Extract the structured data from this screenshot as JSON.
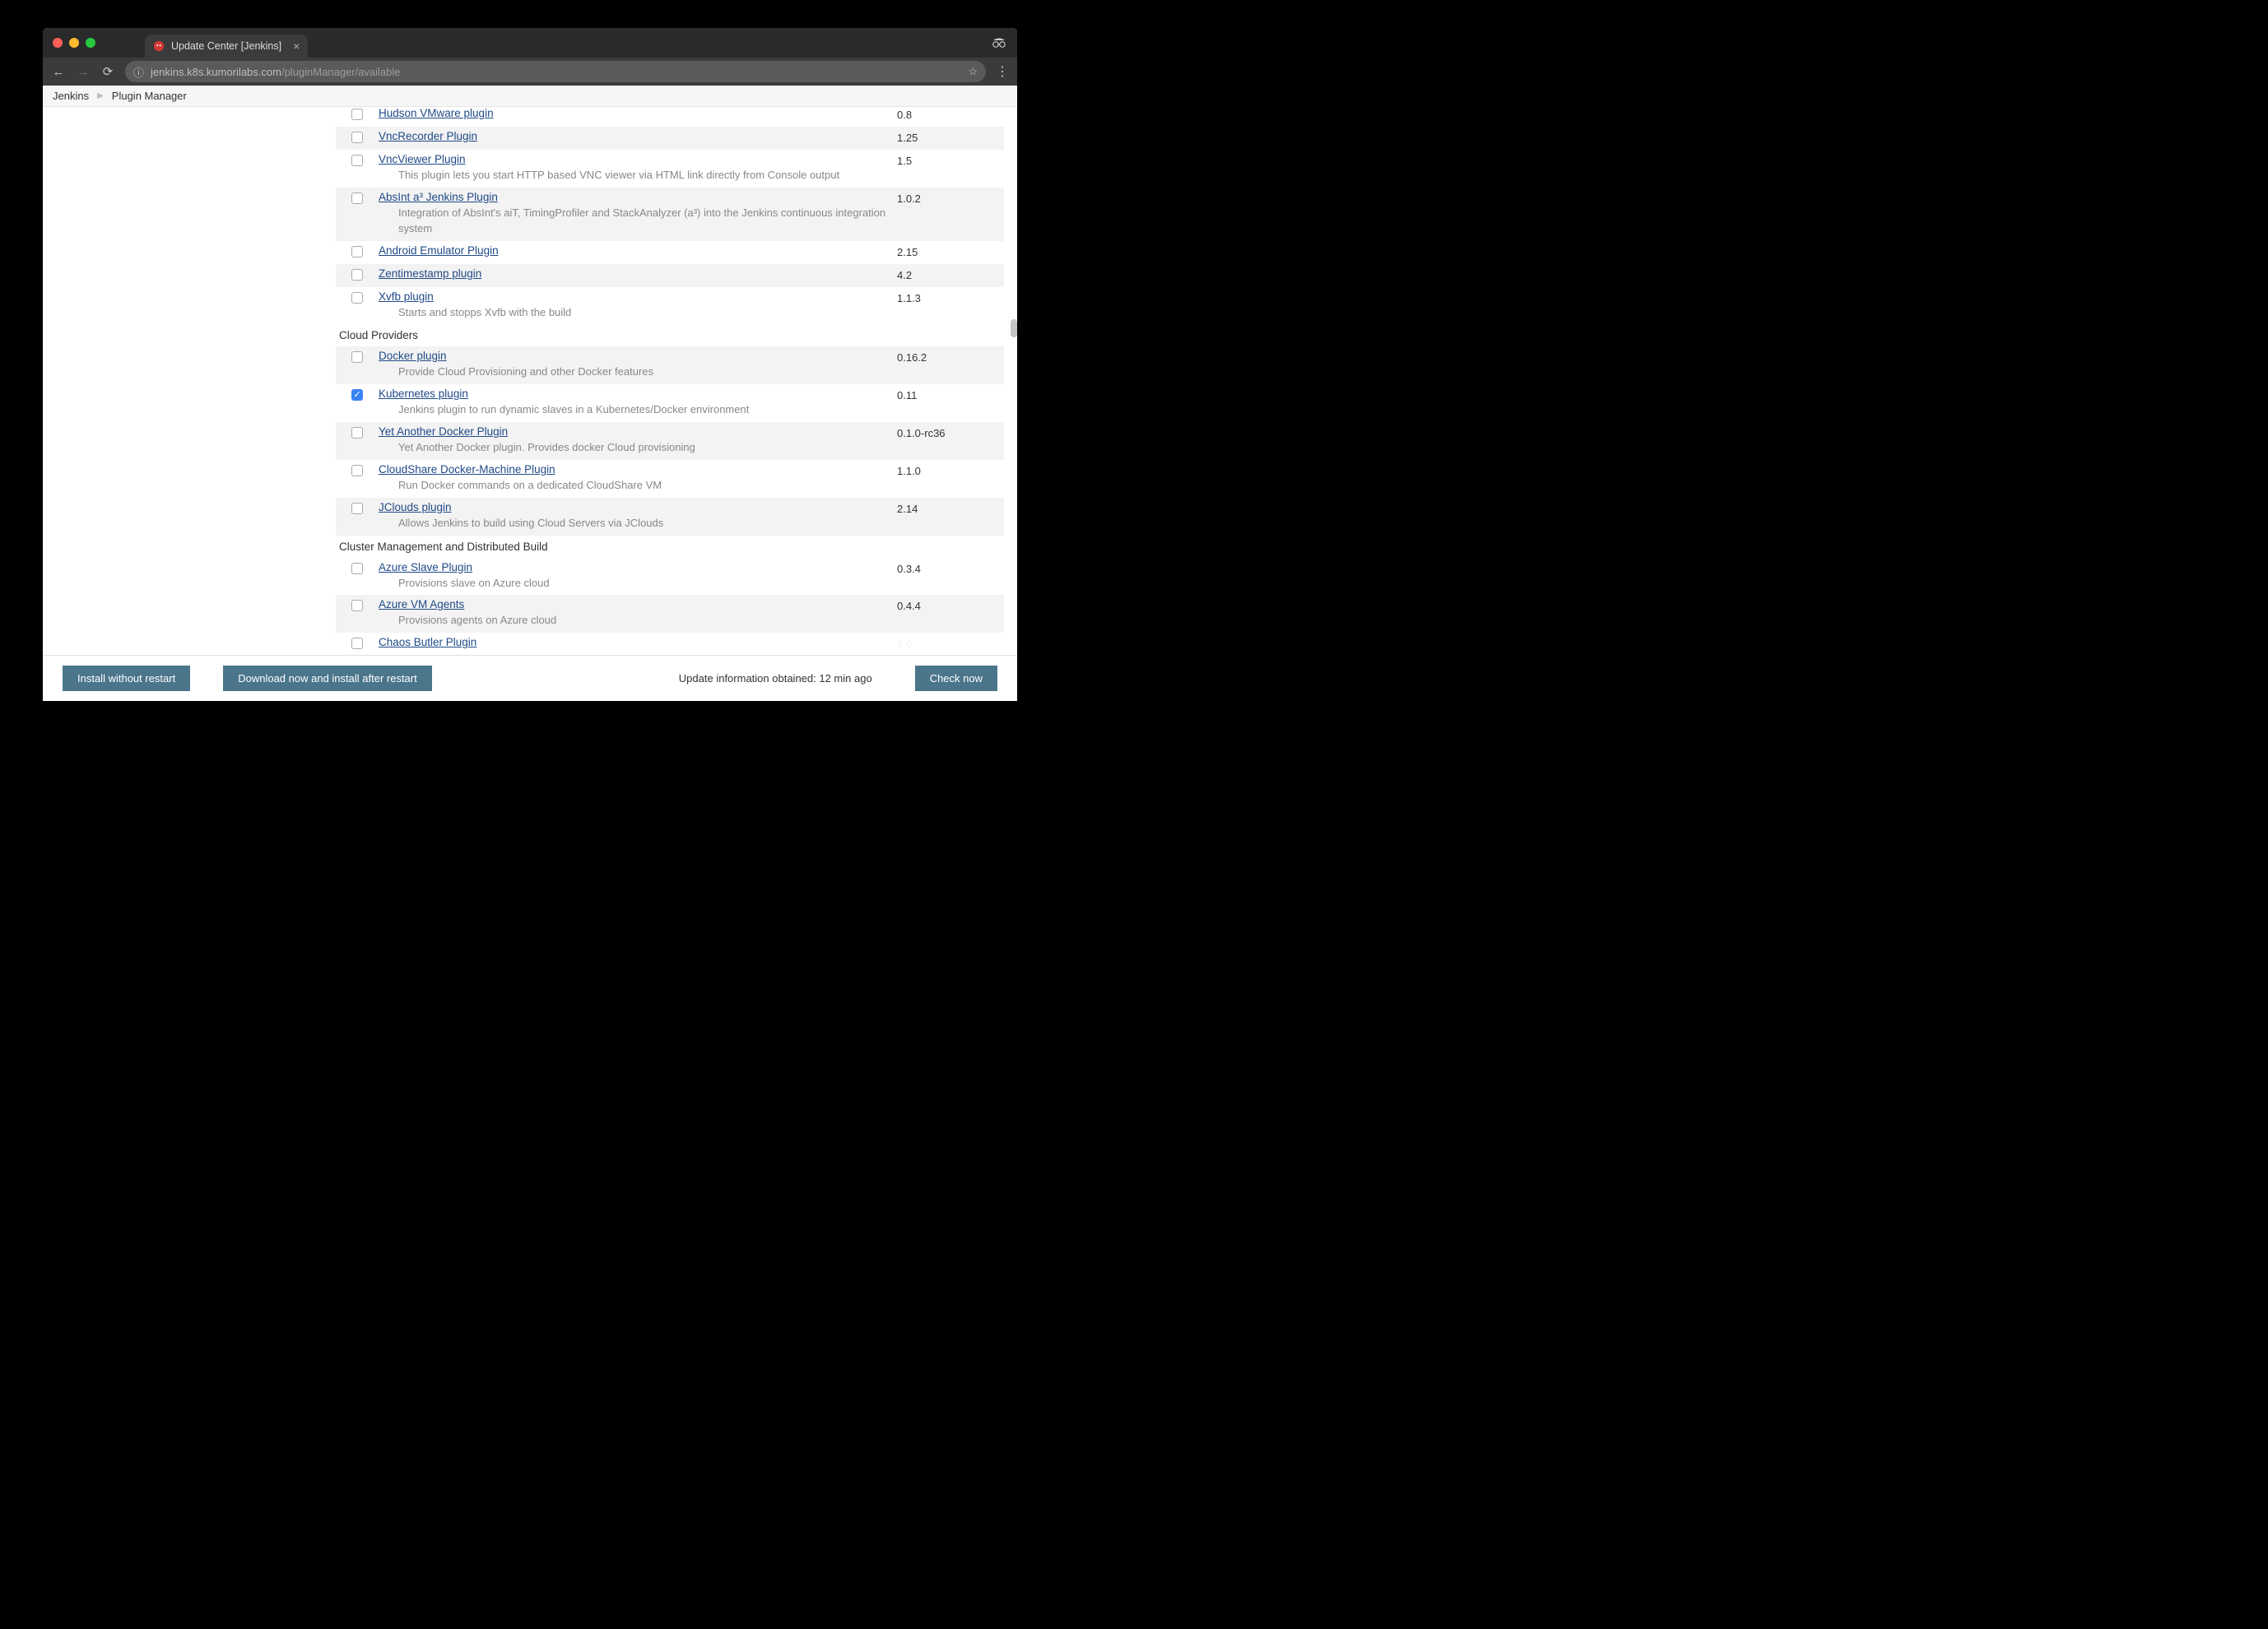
{
  "tab": {
    "title": "Update Center [Jenkins]"
  },
  "url": {
    "host": "jenkins.k8s.kumorilabs.com",
    "path": "/pluginManager/available"
  },
  "breadcrumbs": [
    "Jenkins",
    "Plugin Manager"
  ],
  "plugins": [
    {
      "name": "Hudson VMware plugin",
      "desc": "",
      "ver": "0.8",
      "checked": false,
      "row": "even"
    },
    {
      "name": "VncRecorder Plugin",
      "desc": "",
      "ver": "1.25",
      "checked": false,
      "row": "odd"
    },
    {
      "name": "VncViewer Plugin",
      "desc": "This plugin lets you start HTTP based VNC viewer via HTML link directly from Console output",
      "ver": "1.5",
      "checked": false,
      "row": "even"
    },
    {
      "name": "AbsInt a³ Jenkins Plugin",
      "desc": "Integration of AbsInt's aiT, TimingProfiler and StackAnalyzer (a³) into the Jenkins continuous integration system",
      "ver": "1.0.2",
      "checked": false,
      "row": "odd"
    },
    {
      "name": "Android Emulator Plugin",
      "desc": "",
      "ver": "2.15",
      "checked": false,
      "row": "even"
    },
    {
      "name": "Zentimestamp plugin",
      "desc": "",
      "ver": "4.2",
      "checked": false,
      "row": "odd"
    },
    {
      "name": "Xvfb plugin",
      "desc": "Starts and stopps Xvfb with the build",
      "ver": "1.1.3",
      "checked": false,
      "row": "even"
    },
    {
      "category": "Cloud Providers"
    },
    {
      "name": "Docker plugin",
      "desc": "Provide Cloud Provisioning and other Docker features",
      "ver": "0.16.2",
      "checked": false,
      "row": "odd"
    },
    {
      "name": "Kubernetes plugin",
      "desc": "Jenkins plugin to run dynamic slaves in a Kubernetes/Docker environment",
      "ver": "0.11",
      "checked": true,
      "row": "even"
    },
    {
      "name": "Yet Another Docker Plugin",
      "desc": "Yet Another Docker plugin. Provides docker Cloud provisioning",
      "ver": "0.1.0-rc36",
      "checked": false,
      "row": "odd"
    },
    {
      "name": "CloudShare Docker-Machine Plugin",
      "desc": "Run Docker commands on a dedicated CloudShare VM",
      "ver": "1.1.0",
      "checked": false,
      "row": "even"
    },
    {
      "name": "JClouds plugin",
      "desc": "Allows Jenkins to build using Cloud Servers via JClouds",
      "ver": "2.14",
      "checked": false,
      "row": "odd"
    },
    {
      "category": "Cluster Management and Distributed Build"
    },
    {
      "name": "Azure Slave Plugin",
      "desc": "Provisions slave on Azure cloud",
      "ver": "0.3.4",
      "checked": false,
      "row": "even"
    },
    {
      "name": "Azure VM Agents",
      "desc": "Provisions agents on Azure cloud",
      "ver": "0.4.4",
      "checked": false,
      "row": "odd"
    },
    {
      "name": "Chaos Butler Plugin",
      "desc": "",
      "ver": "1.0",
      "checked": false,
      "row": "even",
      "partial": true
    }
  ],
  "footer": {
    "install": "Install without restart",
    "download": "Download now and install after restart",
    "status": "Update information obtained: 12 min ago",
    "check": "Check now"
  }
}
